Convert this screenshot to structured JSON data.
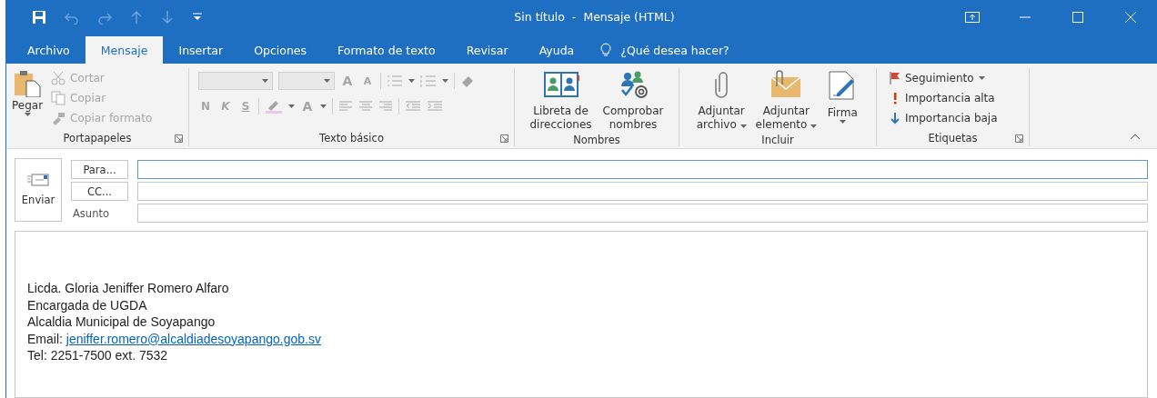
{
  "window": {
    "title": "Sin título  -  Mensaje (HTML)"
  },
  "tabs": [
    {
      "label": "Archivo",
      "selected": false
    },
    {
      "label": "Mensaje",
      "selected": true
    },
    {
      "label": "Insertar",
      "selected": false
    },
    {
      "label": "Opciones",
      "selected": false
    },
    {
      "label": "Formato de texto",
      "selected": false
    },
    {
      "label": "Revisar",
      "selected": false
    },
    {
      "label": "Ayuda",
      "selected": false
    }
  ],
  "tell_me": "¿Qué desea hacer?",
  "clipboard": {
    "title": "Portapapeles",
    "paste": "Pegar",
    "items": [
      {
        "label": "Cortar",
        "disabled": true
      },
      {
        "label": "Copiar",
        "disabled": true
      },
      {
        "label": "Copiar formato",
        "disabled": true
      }
    ]
  },
  "basic_text": {
    "title": "Texto básico",
    "disabled": true,
    "grow": "A",
    "shrink": "A",
    "styles": [
      "N",
      "K",
      "S"
    ],
    "font_color": "A"
  },
  "names": {
    "title": "Nombres",
    "buttons": [
      {
        "lines": [
          "Libreta de",
          "direcciones"
        ]
      },
      {
        "lines": [
          "Comprobar",
          "nombres"
        ]
      }
    ]
  },
  "include": {
    "title": "Incluir",
    "buttons": [
      {
        "lines": [
          "Adjuntar",
          "archivo"
        ]
      },
      {
        "lines": [
          "Adjuntar",
          "elemento"
        ]
      },
      {
        "lines": [
          "Firma"
        ]
      }
    ]
  },
  "tags": {
    "title": "Etiquetas",
    "items": [
      {
        "kind": "flag",
        "label": "Seguimiento"
      },
      {
        "kind": "high",
        "label": "Importancia alta"
      },
      {
        "kind": "low",
        "label": "Importancia baja"
      }
    ]
  },
  "compose": {
    "send": "Enviar",
    "rows": [
      {
        "kind": "button",
        "label": "Para...",
        "focused": true
      },
      {
        "kind": "button",
        "label": "CC...",
        "focused": false
      },
      {
        "kind": "label",
        "label": "Asunto",
        "focused": false
      }
    ]
  },
  "body": [
    {
      "kind": "text",
      "text": "Licda. Gloria Jeniffer Romero Alfaro"
    },
    {
      "kind": "text",
      "text": "Encargada de UGDA"
    },
    {
      "kind": "text",
      "text": "Alcaldia Municipal de Soyapango"
    },
    {
      "kind": "email",
      "text": "Email:",
      "link": "jeniffer.romero@alcaldiadesoyapango.gob.sv"
    },
    {
      "kind": "text",
      "text": "Tel: 2251-7500 ext. 7532"
    }
  ]
}
